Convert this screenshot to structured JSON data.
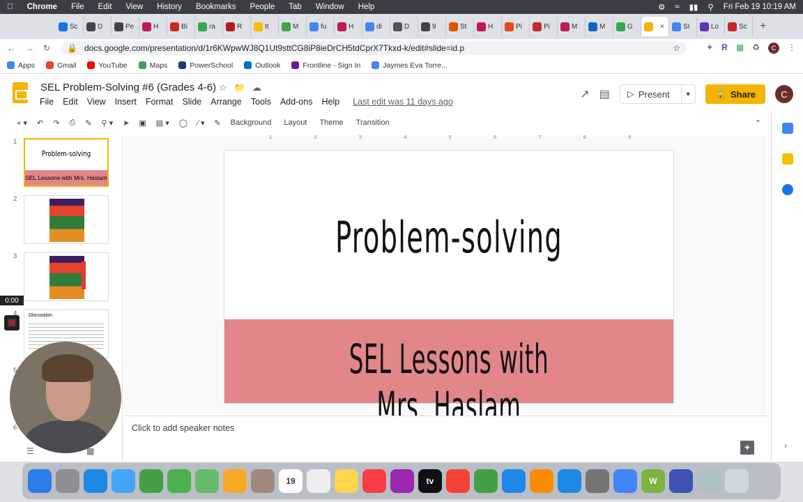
{
  "menubar": {
    "app": "Chrome",
    "items": [
      "File",
      "Edit",
      "View",
      "History",
      "Bookmarks",
      "People",
      "Tab",
      "Window",
      "Help"
    ],
    "clock": "Fri Feb 19  10:19 AM"
  },
  "tabs": [
    {
      "label": "Sc",
      "color": "#1a73e8"
    },
    {
      "label": "D",
      "color": "#444"
    },
    {
      "label": "Pe",
      "color": "#444"
    },
    {
      "label": "H",
      "color": "#c2185b"
    },
    {
      "label": "Bi",
      "color": "#c62828"
    },
    {
      "label": "ra",
      "color": "#34a853"
    },
    {
      "label": "R",
      "color": "#b71c1c"
    },
    {
      "label": "It",
      "color": "#fbbc05"
    },
    {
      "label": "M",
      "color": "#3ea34a"
    },
    {
      "label": "fu",
      "color": "#4285f4"
    },
    {
      "label": "H",
      "color": "#c2185b"
    },
    {
      "label": "di",
      "color": "#4285f4"
    },
    {
      "label": "D",
      "color": "#555"
    },
    {
      "label": "9",
      "color": "#444"
    },
    {
      "label": "St",
      "color": "#e65100"
    },
    {
      "label": "H",
      "color": "#c2185b"
    },
    {
      "label": "Pi",
      "color": "#e64a19"
    },
    {
      "label": "Pi",
      "color": "#c62828"
    },
    {
      "label": "M",
      "color": "#c2185b"
    },
    {
      "label": "M",
      "color": "#1565c0"
    },
    {
      "label": "G",
      "color": "#34a853"
    },
    {
      "label": "",
      "color": "#f4b400",
      "active": true
    },
    {
      "label": "SI",
      "color": "#4285f4"
    },
    {
      "label": "Lo",
      "color": "#5e35b1"
    },
    {
      "label": "Sc",
      "color": "#c62828"
    }
  ],
  "address": {
    "url": "docs.google.com/presentation/d/1r6KWpwWJ8Q1Ut9sttCG8iP8ieDrCH5tdCprX7Tkxd-k/edit#slide=id.p"
  },
  "bookmarks": [
    {
      "label": "Apps",
      "color": "#4285f4"
    },
    {
      "label": "Gmail",
      "color": "#ea4335"
    },
    {
      "label": "YouTube",
      "color": "#ff0000"
    },
    {
      "label": "Maps",
      "color": "#34a853"
    },
    {
      "label": "PowerSchool",
      "color": "#1a3c7a"
    },
    {
      "label": "Outlook",
      "color": "#0072c6"
    },
    {
      "label": "Frontline - Sign In",
      "color": "#6a1b9a"
    },
    {
      "label": "Jaymes Eva Torre...",
      "color": "#4285f4"
    }
  ],
  "doc": {
    "title": "SEL Problem-Solving #6 (Grades 4-6)",
    "menu": [
      "File",
      "Edit",
      "View",
      "Insert",
      "Format",
      "Slide",
      "Arrange",
      "Tools",
      "Add-ons",
      "Help"
    ],
    "last_edit": "Last edit was 11 days ago",
    "present_label": "Present",
    "share_label": "Share",
    "avatar_initial": "C"
  },
  "editbar": {
    "background": "Background",
    "layout": "Layout",
    "theme": "Theme",
    "transition": "Transition"
  },
  "filmstrip": {
    "timer": "0:00",
    "numbers": [
      "1",
      "2",
      "3",
      "4",
      "5",
      "6"
    ],
    "thumb1_title": "Problem-solving",
    "thumb1_sub": "SEL Lessons with Mrs. Haslam",
    "thumb4_title": "Discussion"
  },
  "ruler": [
    "1",
    "2",
    "3",
    "4",
    "5",
    "6",
    "7",
    "8",
    "9"
  ],
  "slide": {
    "title": "Problem-solving",
    "subtitle": "SEL Lessons with Mrs. Haslam",
    "band_color": "#e2868a"
  },
  "notes": {
    "placeholder": "Click to add speaker notes"
  },
  "dock": [
    {
      "name": "finder",
      "color": "#2b7de9"
    },
    {
      "name": "launchpad",
      "color": "#8e8e93"
    },
    {
      "name": "safari",
      "color": "#1e88e5"
    },
    {
      "name": "mail",
      "color": "#42a5f5"
    },
    {
      "name": "facetime",
      "color": "#43a047"
    },
    {
      "name": "messages",
      "color": "#4caf50"
    },
    {
      "name": "maps",
      "color": "#66bb6a"
    },
    {
      "name": "photos",
      "color": "#f9a825"
    },
    {
      "name": "contacts",
      "color": "#a1887f"
    },
    {
      "name": "calendar",
      "color": "#ffffff",
      "label": "19"
    },
    {
      "name": "reminders",
      "color": "#eeeeee"
    },
    {
      "name": "notes",
      "color": "#ffd54f"
    },
    {
      "name": "music",
      "color": "#fc3c44"
    },
    {
      "name": "podcasts",
      "color": "#9c27b0"
    },
    {
      "name": "tv",
      "color": "#111111",
      "label": "tv"
    },
    {
      "name": "news",
      "color": "#f44336"
    },
    {
      "name": "numbers",
      "color": "#43a047"
    },
    {
      "name": "keynote",
      "color": "#1e88e5"
    },
    {
      "name": "pages",
      "color": "#fb8c00"
    },
    {
      "name": "app-store",
      "color": "#1e88e5"
    },
    {
      "name": "system-preferences",
      "color": "#757575"
    },
    {
      "name": "chrome",
      "color": "#4285f4"
    },
    {
      "name": "w-app",
      "color": "#7cb342",
      "label": "W"
    },
    {
      "name": "screencastify",
      "color": "#3f51b5"
    },
    {
      "name": "preview",
      "color": "#b0bec5"
    },
    {
      "name": "trash",
      "color": "#cfd8dc"
    }
  ]
}
